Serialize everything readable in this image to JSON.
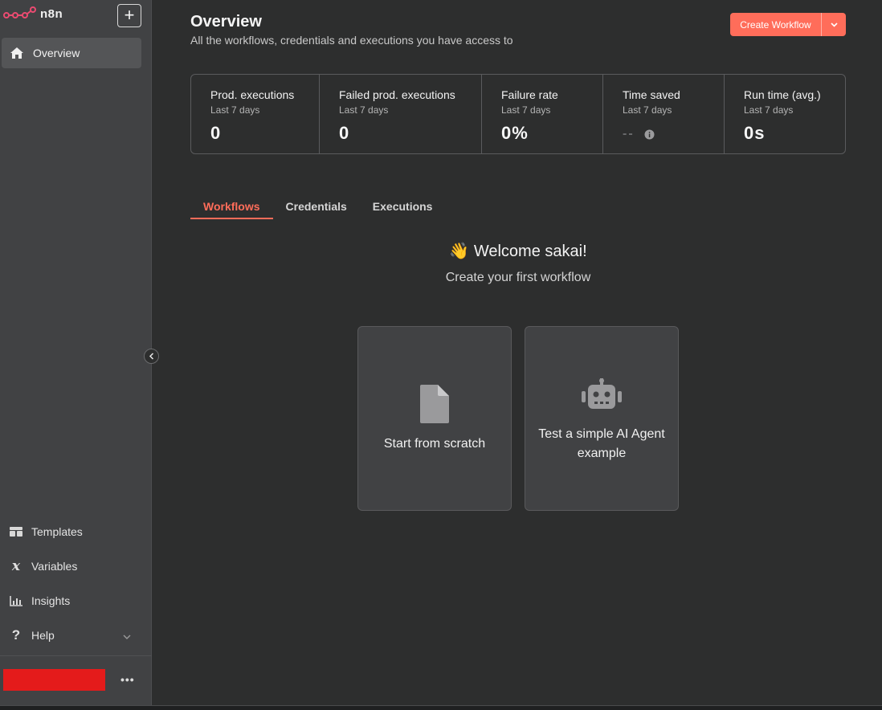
{
  "app": {
    "name": "n8n"
  },
  "sidebar": {
    "overview_label": "Overview",
    "bottom_items": [
      {
        "label": "Templates"
      },
      {
        "label": "Variables"
      },
      {
        "label": "Insights"
      },
      {
        "label": "Help"
      }
    ],
    "more_label": "•••"
  },
  "header": {
    "title": "Overview",
    "subtitle": "All the workflows, credentials and executions you have access to",
    "create_button": "Create Workflow"
  },
  "stats": [
    {
      "label": "Prod. executions",
      "period": "Last 7 days",
      "value": "0"
    },
    {
      "label": "Failed prod. executions",
      "period": "Last 7 days",
      "value": "0"
    },
    {
      "label": "Failure rate",
      "period": "Last 7 days",
      "value": "0%"
    },
    {
      "label": "Time saved",
      "period": "Last 7 days",
      "value": "--"
    },
    {
      "label": "Run time (avg.)",
      "period": "Last 7 days",
      "value": "0s"
    }
  ],
  "tabs": [
    {
      "label": "Workflows",
      "active": true
    },
    {
      "label": "Credentials",
      "active": false
    },
    {
      "label": "Executions",
      "active": false
    }
  ],
  "welcome": {
    "title": "👋 Welcome sakai!",
    "subtitle": "Create your first workflow"
  },
  "cards": [
    {
      "label": "Start from scratch",
      "icon": "file-icon"
    },
    {
      "label": "Test a simple AI Agent example",
      "icon": "robot-icon"
    }
  ],
  "colors": {
    "accent": "#ff6d5a",
    "sidebar": "#414244",
    "background": "#2d2e2e"
  }
}
